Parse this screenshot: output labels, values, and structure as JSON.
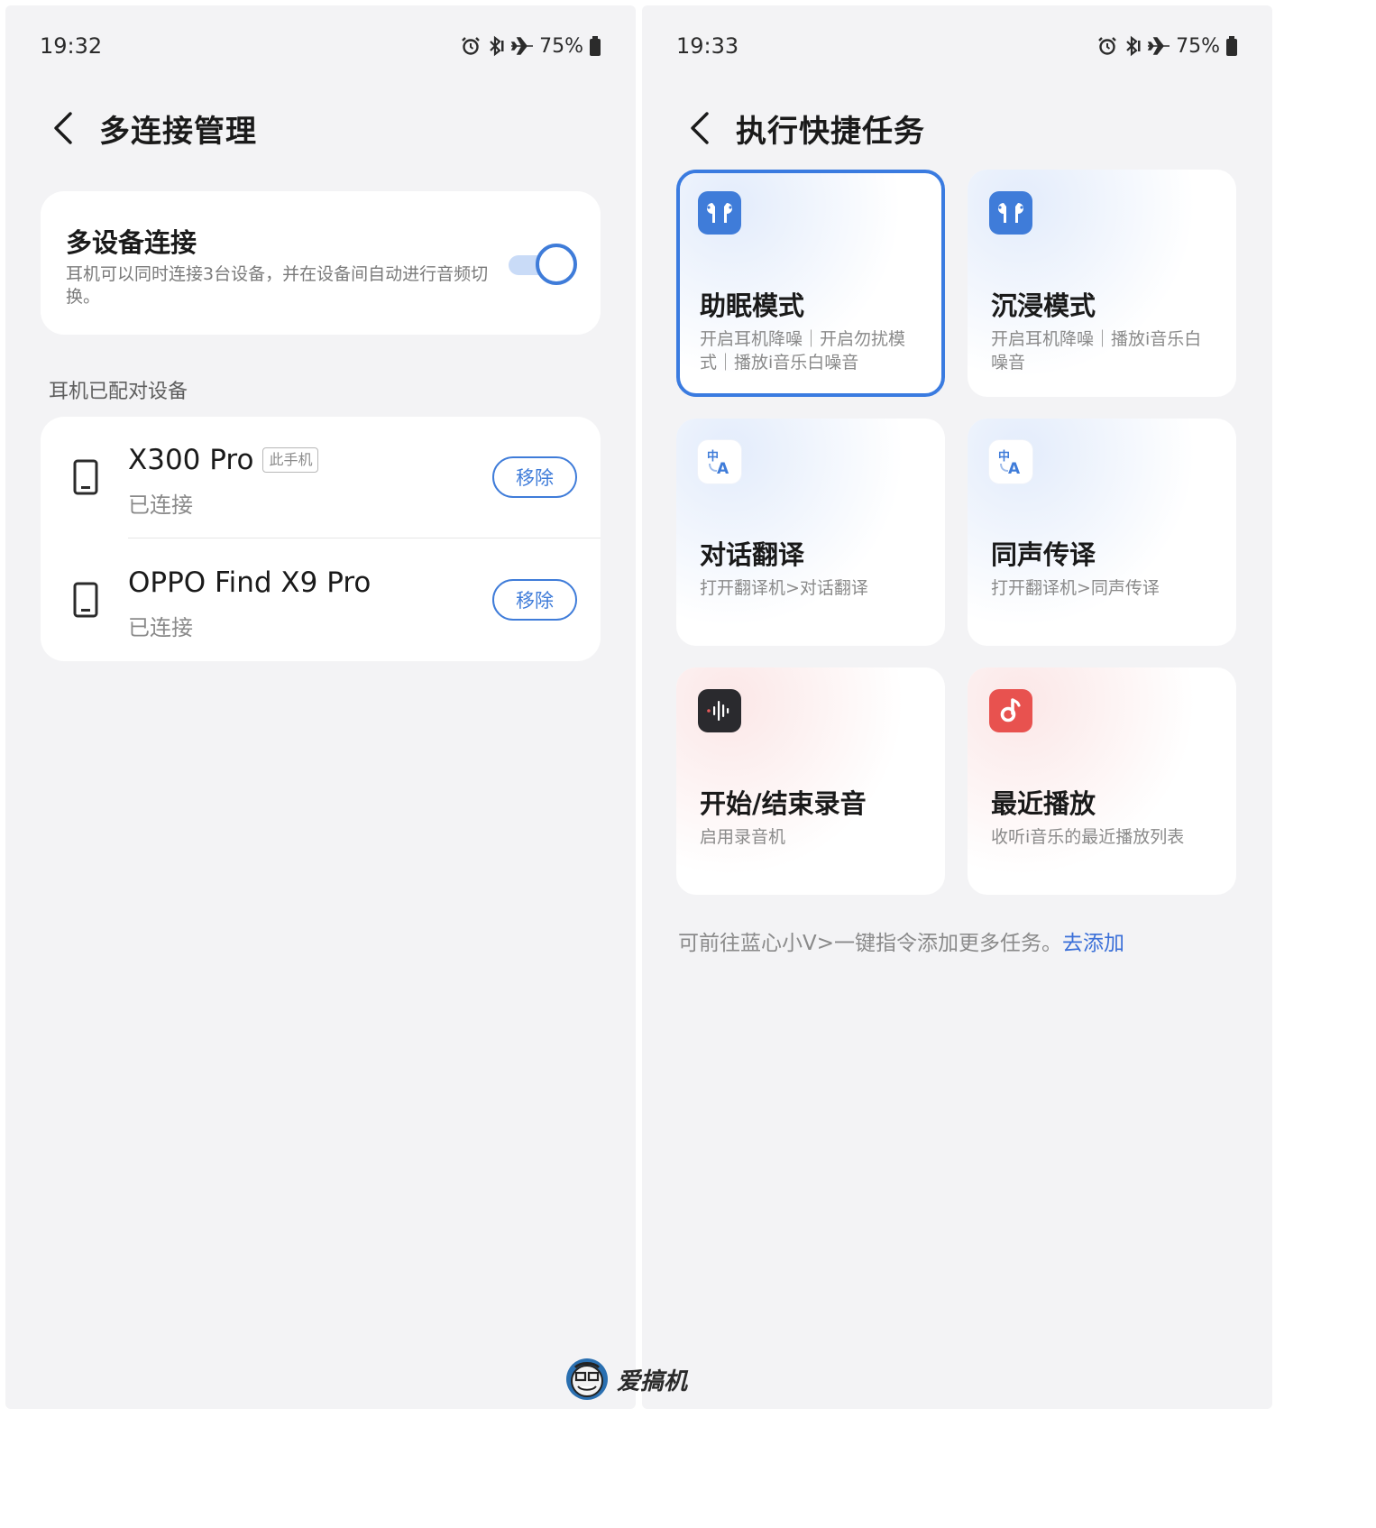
{
  "left": {
    "status": {
      "time": "19:32",
      "battery": "75%"
    },
    "header": {
      "title": "多连接管理"
    },
    "multi_device": {
      "label": "多设备连接",
      "description": "耳机可以同时连接3台设备，并在设备间自动进行音频切换。",
      "enabled": true
    },
    "paired_section_label": "耳机已配对设备",
    "devices": [
      {
        "name": "X300 Pro",
        "tag": "此手机",
        "state": "已连接",
        "action": "移除"
      },
      {
        "name": "OPPO Find X9 Pro",
        "tag": "",
        "state": "已连接",
        "action": "移除"
      }
    ]
  },
  "right": {
    "status": {
      "time": "19:33",
      "battery": "75%"
    },
    "header": {
      "title": "执行快捷任务"
    },
    "tasks": [
      {
        "name": "助眠模式",
        "desc": "开启耳机降噪｜开启勿扰模式｜播放i音乐白噪音",
        "icon": "earbuds-icon",
        "selected": true
      },
      {
        "name": "沉浸模式",
        "desc": "开启耳机降噪｜播放i音乐白噪音",
        "icon": "earbuds-icon",
        "selected": false
      },
      {
        "name": "对话翻译",
        "desc": "打开翻译机>对话翻译",
        "icon": "translate-icon",
        "selected": false
      },
      {
        "name": "同声传译",
        "desc": "打开翻译机>同声传译",
        "icon": "translate-icon",
        "selected": false
      },
      {
        "name": "开始/结束录音",
        "desc": "启用录音机",
        "icon": "recorder-icon",
        "selected": false
      },
      {
        "name": "最近播放",
        "desc": "收听i音乐的最近播放列表",
        "icon": "music-icon",
        "selected": false
      }
    ],
    "footer": {
      "note": "可前往蓝心小V>一键指令添加更多任务。",
      "link": "去添加"
    }
  },
  "watermark": {
    "text": "爱搞机"
  },
  "colors": {
    "accent": "#3f7cd9",
    "link": "#3a6fd8",
    "background": "#f3f3f5",
    "card": "#ffffff"
  }
}
